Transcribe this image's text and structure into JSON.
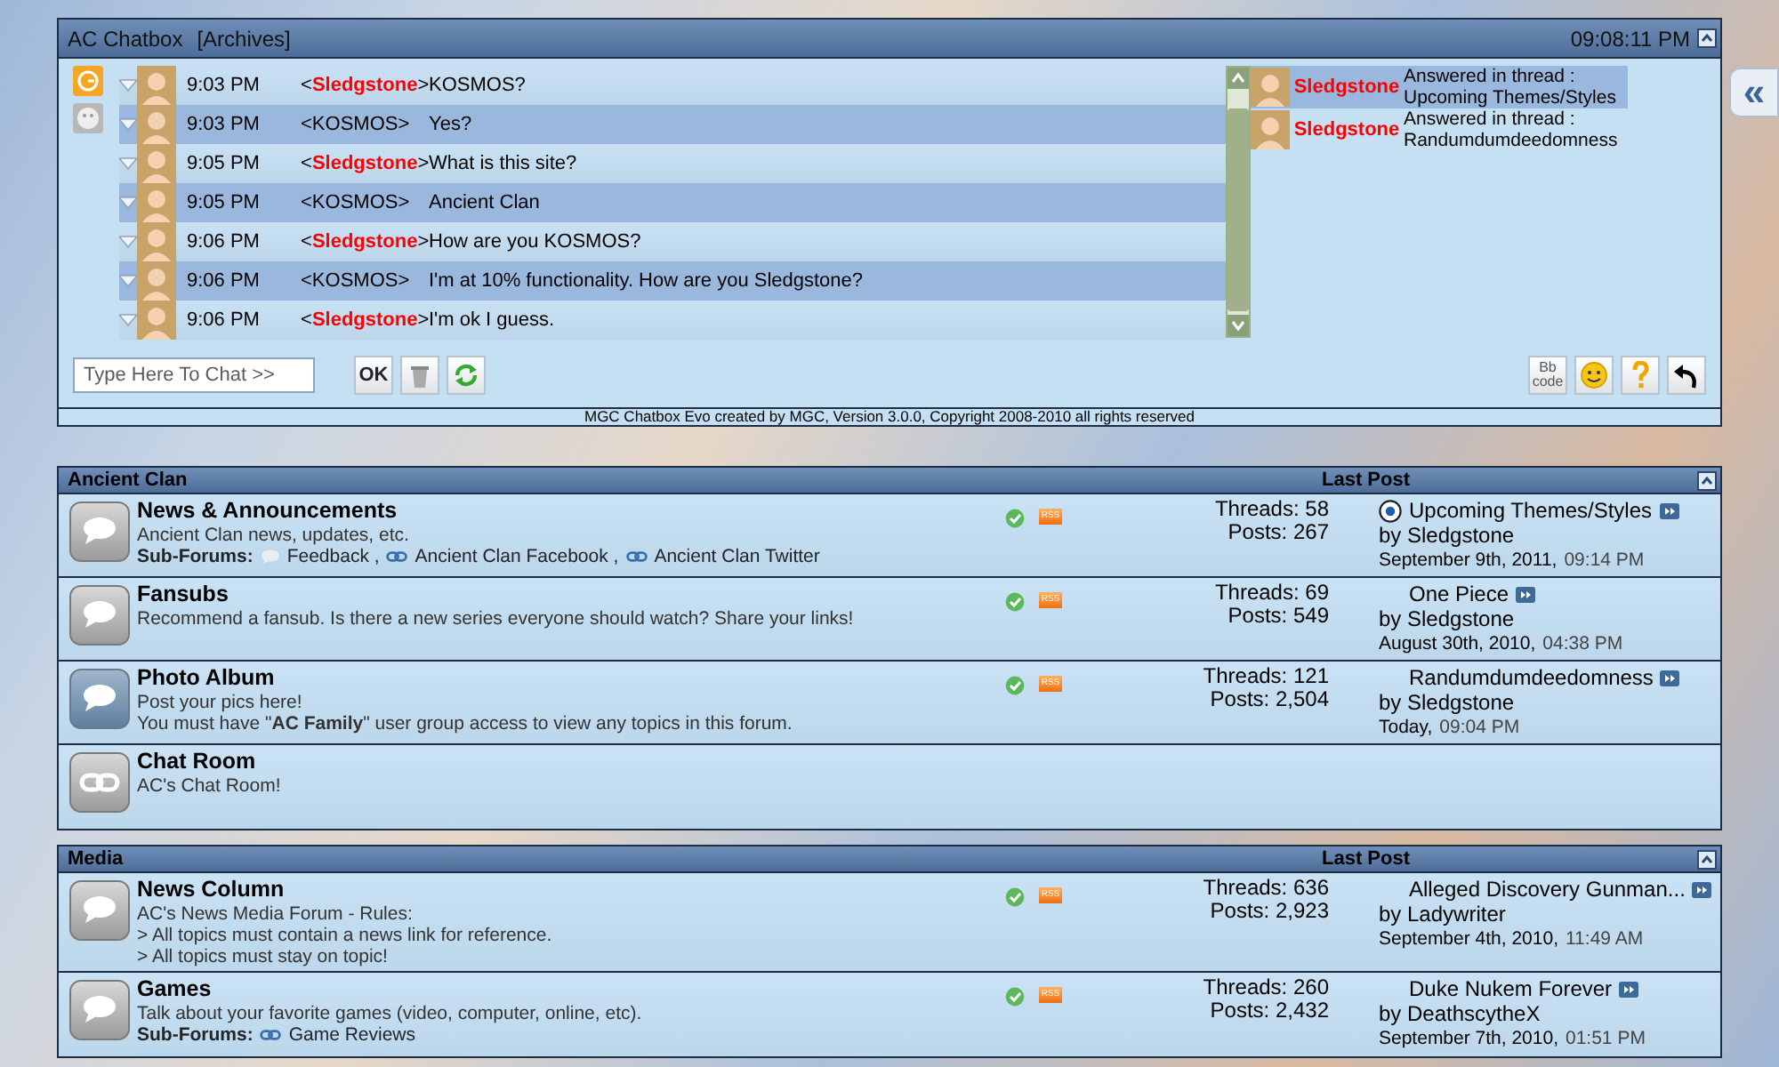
{
  "chatbox": {
    "title": "AC Chatbox",
    "archives_link": "[Archives]",
    "clock": "09:08:11 PM",
    "messages": [
      {
        "time": "9:03 PM",
        "user": "<**Sledgstone**>",
        "color": "#ff0000",
        "text": "KOSMOS?"
      },
      {
        "time": "9:03 PM",
        "user": "<KOSMOS>",
        "text": "Yes?"
      },
      {
        "time": "9:05 PM",
        "user": "<**Sledgstone**>",
        "color": "#ff0000",
        "text": "What is this site?"
      },
      {
        "time": "9:05 PM",
        "user": "<KOSMOS>",
        "text": "Ancient Clan"
      },
      {
        "time": "9:06 PM",
        "user": "<**Sledgstone**>",
        "color": "#ff0000",
        "text": "How are you KOSMOS?"
      },
      {
        "time": "9:06 PM",
        "user": "<KOSMOS>",
        "text": "I'm at 10% functionality. How are you Sledgstone?"
      },
      {
        "time": "9:06 PM",
        "user": "<**Sledgstone**>",
        "color": "#ff0000",
        "text": "I'm ok I guess."
      }
    ],
    "activity": [
      {
        "user": "Sledgstone",
        "color": "#ff0000",
        "action": "Answered in thread :",
        "thread": "Upcoming Themes/Styles",
        "selected": true
      },
      {
        "user": "Sledgstone",
        "color": "#ff0000",
        "action": "Answered in thread :",
        "thread": "Randumdumdeedomness",
        "selected": false
      }
    ],
    "input": {
      "placeholder": "Type Here To Chat >>"
    },
    "ok_button": "OK",
    "bbcode_button": "Bb code",
    "footer": "MGC Chatbox Evo created by MGC, Version 3.0.0, Copyright 2008-2010 all rights reserved"
  },
  "sidebar_toggle": "«",
  "categories": [
    {
      "title": "Ancient Clan",
      "last_post_heading": "Last Post",
      "forums": [
        {
          "kind": "forum",
          "new_posts": false,
          "title": "News & Announcements",
          "description": [
            "Ancient Clan news, updates, etc."
          ],
          "subforums_label": "Sub-Forums:",
          "subforums": [
            {
              "kind": "forum",
              "name": "Feedback ,"
            },
            {
              "kind": "link",
              "name": "Ancient Clan Facebook ,"
            },
            {
              "kind": "link",
              "name": "Ancient Clan Twitter"
            }
          ],
          "threads": "Threads: 58",
          "posts": "Posts: 267",
          "rss": "RSS",
          "last_post": {
            "thread_icon": true,
            "thread": "Upcoming Themes/Styles",
            "by": "by Sledgstone",
            "date": "September 9th, 2011,",
            "time": "09:14 PM"
          }
        },
        {
          "kind": "forum",
          "new_posts": false,
          "title": "Fansubs",
          "description": [
            "Recommend a fansub. Is there a new series everyone should watch? Share your links!"
          ],
          "threads": "Threads: 69",
          "posts": "Posts: 549",
          "rss": "RSS",
          "last_post": {
            "thread_icon": false,
            "thread": "One Piece",
            "by": "by Sledgstone",
            "date": "August 30th, 2010,",
            "time": "04:38 PM"
          }
        },
        {
          "kind": "forum",
          "new_posts": true,
          "title": "Photo Album",
          "description": [
            "Post your pics here!",
            "You must have \"**AC Family**\" user group access to view any topics in this forum."
          ],
          "threads": "Threads: 121",
          "posts": "Posts: 2,504",
          "rss": "RSS",
          "last_post": {
            "thread_icon": false,
            "thread": "Randumdumdeedomness",
            "by": "by Sledgstone",
            "date": "Today,",
            "time": "09:04 PM"
          }
        },
        {
          "kind": "link",
          "new_posts": false,
          "title": "Chat Room",
          "description": [
            "AC's Chat Room!"
          ]
        }
      ]
    },
    {
      "title": "Media",
      "last_post_heading": "Last Post",
      "forums": [
        {
          "kind": "forum",
          "new_posts": false,
          "title": "News Column",
          "description": [
            "AC's News Media Forum - Rules:",
            "> All topics must contain a news link for reference.",
            "> All topics must stay on topic!"
          ],
          "threads": "Threads: 636",
          "posts": "Posts: 2,923",
          "rss": "RSS",
          "last_post": {
            "thread_icon": false,
            "thread": "Alleged Discovery Gunman...",
            "by": "by Ladywriter",
            "date": "September 4th, 2010,",
            "time": "11:49 AM"
          }
        },
        {
          "kind": "forum",
          "new_posts": false,
          "title": "Games",
          "description": [
            "Talk about your favorite games (video, computer, online, etc)."
          ],
          "subforums_label": "Sub-Forums:",
          "subforums": [
            {
              "kind": "link",
              "name": "Game Reviews"
            }
          ],
          "threads": "Threads: 260",
          "posts": "Posts: 2,432",
          "rss": "RSS",
          "last_post": {
            "thread_icon": false,
            "thread": "Duke Nukem Forever",
            "by": "by DeathscytheX",
            "date": "September 7th, 2010,",
            "time": "01:51 PM"
          }
        }
      ]
    }
  ]
}
